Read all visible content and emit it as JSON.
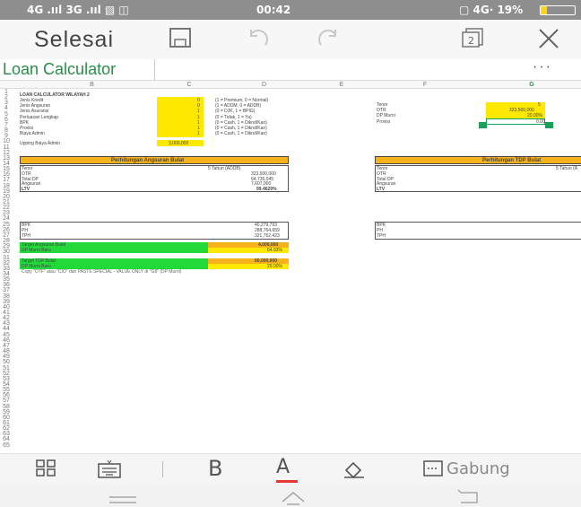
{
  "status_bar": {
    "left": "4G .ııl 3G .ııl ▧ ◫",
    "time": "00:42",
    "right": "▢ 4G· 19%",
    "battery_level": 0.19
  },
  "toolbar": {
    "done_label": "Selesai",
    "save_icon": "save-icon",
    "undo_icon": "undo-icon",
    "redo_icon": "redo-icon",
    "tabs_count": "2",
    "close_icon": "close-icon"
  },
  "document": {
    "title": "Loan Calculator",
    "more_label": "···"
  },
  "sheet": {
    "columns": [
      "B",
      "C",
      "D",
      "E",
      "F",
      "G"
    ],
    "rows": [
      "1",
      "2",
      "3",
      "4",
      "5",
      "6",
      "7",
      "8",
      "9",
      "10",
      "11",
      "12",
      "13",
      "14",
      "15",
      "16",
      "17",
      "18",
      "19",
      "20",
      "21",
      "22",
      "23",
      "24",
      "25",
      "26",
      "27",
      "28",
      "29",
      "30",
      "31",
      "32",
      "33",
      "34",
      "35",
      "36",
      "37",
      "38",
      "39",
      "40",
      "41",
      "42",
      "43",
      "44",
      "45",
      "46",
      "47",
      "48",
      "49",
      "50",
      "51",
      "52",
      "53",
      "54",
      "55",
      "56",
      "57",
      "58",
      "59",
      "60",
      "61",
      "62",
      "63",
      "64",
      "65"
    ],
    "heading": "LOAN CALCULATOR WILAYAH 2",
    "inputs_left": [
      {
        "label": "Jenis Kredit",
        "value": "0",
        "note": "(1 = Premium, 0 = Normal)"
      },
      {
        "label": "Jenis Angsuran",
        "value": "0",
        "note": "(1 = ADDM, 0 = ADDB)"
      },
      {
        "label": "Jenis Asuransi",
        "value": "1",
        "note": "(0 = DJK, 1 = BPIG)"
      },
      {
        "label": "Perluasan Lengkap",
        "value": "1",
        "note": "(0 = Tidak, 1 = Ya)"
      },
      {
        "label": "BPK",
        "value": "1",
        "note": "(0 = Cash, 1 = Diknd/Kan)"
      },
      {
        "label": "Provisi",
        "value": "1",
        "note": "(0 = Cash, 1 = Diknd/Kan)"
      },
      {
        "label": "Biaya Admin",
        "value": "1",
        "note": "(0 = Cash, 1 = Diknd/Kan)"
      }
    ],
    "upping_label": "Upping Biaya Admin",
    "upping_value": "3,000,000",
    "inputs_right": [
      {
        "label": "Tenor",
        "value": "5"
      },
      {
        "label": "OTR",
        "value": "323,500,000"
      },
      {
        "label": "DP Murni",
        "value": "20.00%"
      },
      {
        "label": "Provisi",
        "value": "0.00"
      }
    ],
    "section_left": {
      "title": "Perhitungan Angsuran Bulat",
      "rows": [
        {
          "label": "Tenor",
          "value": "5 Tahun (ADDB)"
        },
        {
          "label": "OTR",
          "value": "323,500,000"
        },
        {
          "label": "Total DP",
          "value": "64,735,045"
        },
        {
          "label": "Angsuran",
          "value": "7,607,000"
        }
      ],
      "ltv_label": "LTV",
      "ltv_value": "99.4629%",
      "totals": [
        {
          "label": "BPK",
          "value": "40,279,793"
        },
        {
          "label": "PH",
          "value": "288,764,659"
        },
        {
          "label": "TPH",
          "value": "321,762,423"
        }
      ]
    },
    "section_right": {
      "title": "Perhitungan TDP Bulat",
      "rows": [
        {
          "label": "Tenor",
          "value": "5 Tahun (A"
        },
        {
          "label": "OTR",
          "value": ""
        },
        {
          "label": "Total DP",
          "value": ""
        },
        {
          "label": "Angsuran",
          "value": ""
        }
      ],
      "ltv_label": "LTV",
      "totals": [
        {
          "label": "BPK",
          "value": ""
        },
        {
          "label": "PH",
          "value": ""
        },
        {
          "label": "TPH",
          "value": ""
        }
      ]
    },
    "target_angsuran": {
      "label": "Target Angsuran Bulat",
      "value": "4,000,000",
      "dp_label": "DP Murni Baru",
      "dp_value": "64.93%"
    },
    "target_tdp": {
      "label": "Target TDP Bulat",
      "value": "60,000,000",
      "dp_label": "DP Murni Baru",
      "dp_value": "20.00%"
    },
    "footnote": "Copy \"OTF\" atau \"CIO\" dan PASTE SPECIAL - VALUE ONLY di \"G8\" (DP Murni)"
  },
  "format_bar": {
    "items": [
      "grid-icon",
      "keyboard-icon",
      "bold-icon",
      "font-color-icon",
      "fill-icon",
      "merge-icon"
    ],
    "bold_label": "B",
    "font_color_label": "A",
    "merge_label": "Gabung",
    "font_color_underline": "#e53935"
  },
  "nav_bar": {
    "items": [
      "menu-icon",
      "home-icon",
      "back-icon"
    ]
  },
  "colors": {
    "title_green": "#2a8c4a",
    "input_yellow": "#ffe800",
    "header_orange": "#f6b21a",
    "target_green": "#22d93a"
  }
}
